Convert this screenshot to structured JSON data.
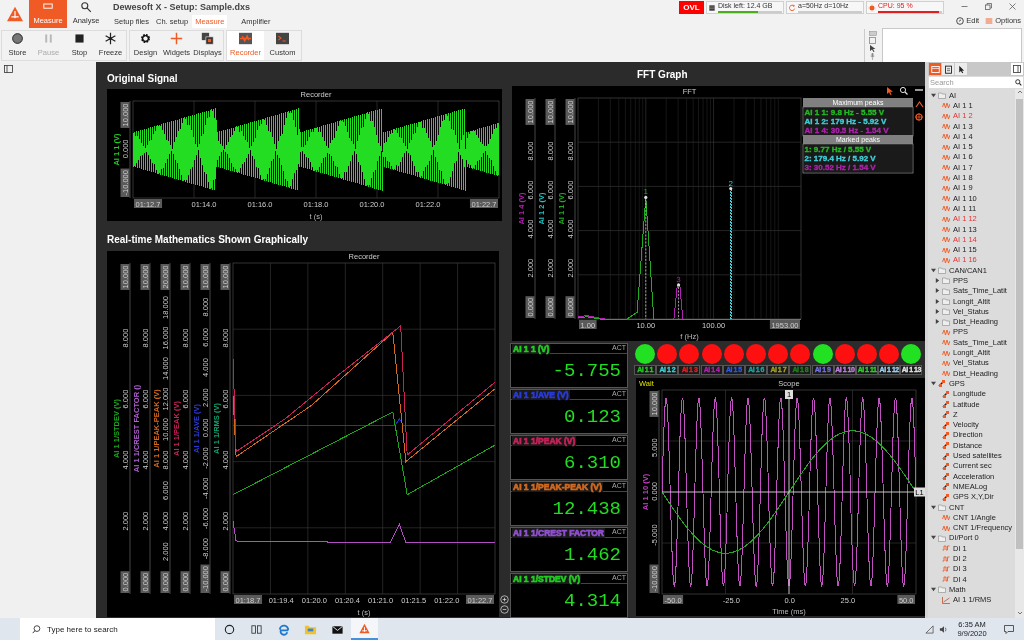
{
  "app_title": "Dewesoft X - Setup: Sample.dxs",
  "main_tabs": [
    {
      "label": "Measure",
      "kind": "measure",
      "selected": true
    },
    {
      "label": "Analyse",
      "kind": "analyse",
      "selected": false
    }
  ],
  "sub_tabs": [
    {
      "label": "Setup files",
      "selected": false
    },
    {
      "label": "Ch. setup",
      "selected": false
    },
    {
      "label": "Measure",
      "selected": true
    },
    {
      "label": "Amplifier",
      "selected": false
    }
  ],
  "toolbar_groups": [
    {
      "items": [
        {
          "label": "Store",
          "kind": "store",
          "disabled": false,
          "selected": false
        },
        {
          "label": "Pause",
          "kind": "pause",
          "disabled": true,
          "selected": false
        },
        {
          "label": "Stop",
          "kind": "stop",
          "disabled": false,
          "selected": false
        },
        {
          "label": "Freeze",
          "kind": "freeze",
          "disabled": false,
          "selected": false
        }
      ]
    },
    {
      "items": [
        {
          "label": "Design",
          "kind": "design",
          "disabled": false,
          "selected": false
        },
        {
          "label": "Widgets",
          "kind": "widgets",
          "disabled": false,
          "selected": false
        },
        {
          "label": "Displays",
          "kind": "displays",
          "disabled": false,
          "selected": false
        }
      ]
    },
    {
      "items": [
        {
          "label": "Recorder",
          "kind": "recorder",
          "disabled": false,
          "selected": true
        },
        {
          "label": "Custom",
          "kind": "custom",
          "disabled": false,
          "selected": false
        }
      ]
    }
  ],
  "overload": "OVL",
  "indicators": [
    {
      "kind": "disk",
      "text": "Disk left: 12.4 GB",
      "level": 0.62
    },
    {
      "kind": "rate",
      "text": "a=50Hz d=10Hz"
    },
    {
      "kind": "cpu",
      "text": "CPU: 95 %",
      "level": 0.95
    }
  ],
  "edit_button": "Edit",
  "options_button": "Options",
  "original_signal": {
    "heading": "Original Signal",
    "chart": {
      "title": "Recorder",
      "xlabel": "t (s)",
      "axes": [
        {
          "label": "AI 1 1 (V)",
          "color": "#22cc22",
          "ticks": [
            "10.000",
            "0.000",
            "-10.000"
          ]
        }
      ],
      "xticks": [
        "01:12.7",
        "01:14.0",
        "01:16.0",
        "01:18.0",
        "01:20.0",
        "01:22.0",
        "01:22.7"
      ],
      "traces": [
        {
          "kind": "burst",
          "color": "#22dd22"
        }
      ]
    }
  },
  "math": {
    "heading": "Real-time Mathematics Shown Graphically",
    "chart": {
      "title": "Recorder",
      "xlabel": "t (s)",
      "axes": [
        {
          "label": "AI 1 1/STDEV (V)",
          "color": "#1aa81a",
          "ticks": [
            "10.000",
            "8.000",
            "6.000",
            "4.000",
            "2.000",
            "0.000"
          ]
        },
        {
          "label": "AI 1 1/CREST FACTOR ()",
          "color": "#b060d0",
          "ticks": [
            "10.000",
            "8.000",
            "6.000",
            "4.000",
            "2.000",
            "0.000"
          ]
        },
        {
          "label": "AI 1 1/PEAK-PEAK (V)",
          "color": "#d2691e",
          "ticks": [
            "20.000",
            "18.000",
            "16.000",
            "14.000",
            "12.000",
            "10.000",
            "8.000",
            "6.000",
            "4.000",
            "2.000",
            "0.000"
          ]
        },
        {
          "label": "AI 1 1/PEAK (V)",
          "color": "#c8205a",
          "ticks": [
            "10.000",
            "8.000",
            "6.000",
            "4.000",
            "2.000",
            "0.000"
          ]
        },
        {
          "label": "AI 1 1/AVE (V)",
          "color": "#2a3ad8",
          "ticks": [
            "10.000",
            "8.000",
            "6.000",
            "4.000",
            "2.000",
            "0.000",
            "-2.000",
            "-4.000",
            "-6.000",
            "-8.000",
            "-10.000"
          ]
        },
        {
          "label": "AI 1 1/RMS (V)",
          "color": "#10a070",
          "ticks": [
            "10.000",
            "8.000",
            "6.000",
            "4.000",
            "2.000",
            "0.000"
          ]
        }
      ],
      "xticks": [
        "01:18.7",
        "01:19.4",
        "01:20.0",
        "01:20.4",
        "01:21.0",
        "01:21.5",
        "01:22.0",
        "01:22.7"
      ],
      "traces": [
        {
          "kind": "flat",
          "color": "#2a2ad0"
        },
        {
          "kind": "sawtooth_lead",
          "color": "#d2691e"
        },
        {
          "kind": "sawtooth",
          "color": "#c8205a"
        },
        {
          "kind": "sawtooth_low",
          "color": "#1aa81a"
        },
        {
          "kind": "pulse",
          "color": "#b050c0"
        }
      ]
    }
  },
  "fft": {
    "heading": "FFT Graph",
    "chart": {
      "title": "FFT",
      "xlabel": "f (Hz)",
      "axes": [
        {
          "label": "AI 1 4 (V)",
          "color": "#b020b0",
          "ticks": [
            "10.000",
            "8.000",
            "6.000",
            "4.000",
            "2.000",
            "0.000"
          ]
        },
        {
          "label": "AI 1 2 (V)",
          "color": "#20c0c0",
          "ticks": [
            "10.000",
            "8.000",
            "6.000",
            "4.000",
            "2.000",
            "0.000"
          ]
        },
        {
          "label": "AI 1 1 (V)",
          "color": "#22aa22",
          "ticks": [
            "10.000",
            "8.000",
            "6.000",
            "4.000",
            "2.000",
            "0.000"
          ]
        }
      ],
      "xticks": [
        "1.00",
        "10.00",
        "100.00",
        "1953.00"
      ],
      "traces": [
        {
          "kind": "peak_small",
          "color": "#b020b0",
          "marker": "3"
        },
        {
          "kind": "peak_wide",
          "color": "#22aa22",
          "marker": "1"
        },
        {
          "kind": "spike",
          "color": "#40d0d8",
          "marker": "2"
        }
      ]
    },
    "max_peaks": {
      "title": "Maximum peaks",
      "entries": [
        {
          "text": "AI 1 1: 9.8 Hz - 5.55 V",
          "color": "#22bb22"
        },
        {
          "text": "AI 1 2: 179 Hz - 5.92 V",
          "color": "#40d0d8"
        },
        {
          "text": "AI 1 4: 30.5 Hz - 1.54 V",
          "color": "#b020b0"
        }
      ]
    },
    "marked_peaks": {
      "title": "Marked peaks",
      "entries": [
        {
          "text": "1: 9.77 Hz / 5.55 V",
          "color": "#22bb22"
        },
        {
          "text": "2: 179.4 Hz / 5.92 V",
          "color": "#40d0d8"
        },
        {
          "text": "3: 30.52 Hz / 1.54 V",
          "color": "#b020b0"
        }
      ]
    }
  },
  "meters": [
    {
      "label": "AI 1 1 (V)",
      "color": "#22cc22",
      "mode": "ACT",
      "value": "-5.755"
    },
    {
      "label": "AI 1 1/AVE (V)",
      "color": "#2a3ad8",
      "mode": "ACT",
      "value": "0.123"
    },
    {
      "label": "AI 1 1/PEAK (V)",
      "color": "#c8205a",
      "mode": "ACT",
      "value": "6.310"
    },
    {
      "label": "AI 1 1/PEAK-PEAK (V)",
      "color": "#d2691e",
      "mode": "ACT",
      "value": "12.438"
    },
    {
      "label": "AI 1 1/CREST FACTOR",
      "color": "#9050d0",
      "mode": "ACT",
      "value": "1.462"
    },
    {
      "label": "AI 1 1/STDEV (V)",
      "color": "#22cc22",
      "mode": "ACT",
      "value": "4.314"
    }
  ],
  "leds": [
    {
      "label": "AI 1 1",
      "color": "#22cc22",
      "on": true
    },
    {
      "label": "AI 1 2",
      "color": "#40d0d8",
      "on": false
    },
    {
      "label": "AI 1 3",
      "color": "#e02020",
      "on": false
    },
    {
      "label": "AI 1 4",
      "color": "#b020b0",
      "on": false
    },
    {
      "label": "AI 1 5",
      "color": "#2a5ae8",
      "on": false
    },
    {
      "label": "AI 1 6",
      "color": "#20a0a0",
      "on": false
    },
    {
      "label": "AI 1 7",
      "color": "#a0a020",
      "on": false
    },
    {
      "label": "AI 1 8",
      "color": "#208020",
      "on": false
    },
    {
      "label": "AI 1 9",
      "color": "#7070e0",
      "on": true
    },
    {
      "label": "AI 1 10",
      "color": "#c080e0",
      "on": false
    },
    {
      "label": "AI 1 11",
      "color": "#30d030",
      "on": false
    },
    {
      "label": "AI 1 12",
      "color": "#a0d0f0",
      "on": false
    },
    {
      "label": "AI 1 13",
      "color": "#e0e0e0",
      "on": true
    }
  ],
  "scope": {
    "status": "Wait",
    "cursor_label": "1",
    "level_label": "L1",
    "chart": {
      "title": "Scope",
      "xlabel": "Time (ms)",
      "axes": [
        {
          "label": "AI 1 10 (V)",
          "color": "#c040c0",
          "ticks": [
            "10.000",
            "5.000",
            "0.000",
            "-5.000",
            "-10.000"
          ]
        }
      ],
      "xticks": [
        "-50.0",
        "-25.0",
        "0.0",
        "25.0",
        "50.0"
      ],
      "traces": [
        {
          "kind": "sine_fast",
          "color": "#c050c0"
        },
        {
          "kind": "sine_slow",
          "color": "#22a822"
        }
      ]
    }
  },
  "sidebar": {
    "tabs": [
      {
        "kind": "channels",
        "selected": true
      },
      {
        "kind": "list",
        "selected": false
      },
      {
        "kind": "pointer",
        "selected": false
      }
    ],
    "search": {
      "placeholder": "Search"
    },
    "tree": [
      {
        "label": "AI",
        "kind": "folder",
        "expanded": true,
        "children": [
          {
            "label": "AI 1 1",
            "kind": "analog",
            "active": false
          },
          {
            "label": "AI 1 2",
            "kind": "analog",
            "active": true
          },
          {
            "label": "AI 1 3",
            "kind": "analog",
            "active": false
          },
          {
            "label": "AI 1 4",
            "kind": "analog",
            "active": false
          },
          {
            "label": "AI 1 5",
            "kind": "analog",
            "active": false
          },
          {
            "label": "AI 1 6",
            "kind": "analog",
            "active": false
          },
          {
            "label": "AI 1 7",
            "kind": "analog",
            "active": false
          },
          {
            "label": "AI 1 8",
            "kind": "analog",
            "active": false
          },
          {
            "label": "AI 1 9",
            "kind": "analog",
            "active": false
          },
          {
            "label": "AI 1 10",
            "kind": "analog",
            "active": false
          },
          {
            "label": "AI 1 11",
            "kind": "analog",
            "active": false
          },
          {
            "label": "AI 1 12",
            "kind": "analog",
            "active": true
          },
          {
            "label": "AI 1 13",
            "kind": "analog",
            "active": false
          },
          {
            "label": "AI 1 14",
            "kind": "analog",
            "active": true
          },
          {
            "label": "AI 1 15",
            "kind": "analog",
            "active": false
          },
          {
            "label": "AI 1 16",
            "kind": "analog",
            "active": true
          }
        ]
      },
      {
        "label": "CAN/CAN1",
        "kind": "folder",
        "expanded": true,
        "children": [
          {
            "label": "PPS",
            "kind": "folder",
            "expanded": false
          },
          {
            "label": "Sats_Time_Latit",
            "kind": "folder",
            "expanded": false
          },
          {
            "label": "Longit_Altit",
            "kind": "folder",
            "expanded": false
          },
          {
            "label": "Vel_Status",
            "kind": "folder",
            "expanded": false
          },
          {
            "label": "Dist_Heading",
            "kind": "folder",
            "expanded": false
          },
          {
            "label": "PPS",
            "kind": "analog"
          },
          {
            "label": "Sats_Time_Latit",
            "kind": "analog"
          },
          {
            "label": "Longit_Altit",
            "kind": "analog"
          },
          {
            "label": "Vel_Status",
            "kind": "analog"
          },
          {
            "label": "Dist_Heading",
            "kind": "analog"
          }
        ]
      },
      {
        "label": "GPS",
        "kind": "gps_folder",
        "expanded": true,
        "children": [
          {
            "label": "Longitude",
            "kind": "gps"
          },
          {
            "label": "Latitude",
            "kind": "gps"
          },
          {
            "label": "Z",
            "kind": "gps"
          },
          {
            "label": "Velocity",
            "kind": "gps"
          },
          {
            "label": "Direction",
            "kind": "gps"
          },
          {
            "label": "Distance",
            "kind": "gps"
          },
          {
            "label": "Used satellites",
            "kind": "gps"
          },
          {
            "label": "Current sec",
            "kind": "gps"
          },
          {
            "label": "Acceleration",
            "kind": "gps"
          },
          {
            "label": "NMEALog",
            "kind": "gps"
          },
          {
            "label": "GPS X,Y,Dir",
            "kind": "gps"
          }
        ]
      },
      {
        "label": "CNT",
        "kind": "folder",
        "expanded": true,
        "children": [
          {
            "label": "CNT 1/Angle",
            "kind": "analog"
          },
          {
            "label": "CNT 1/Frequency",
            "kind": "analog"
          }
        ]
      },
      {
        "label": "DI/Port 0",
        "kind": "folder",
        "expanded": true,
        "children": [
          {
            "label": "DI 1",
            "kind": "digital"
          },
          {
            "label": "DI 2",
            "kind": "digital"
          },
          {
            "label": "DI 3",
            "kind": "digital"
          },
          {
            "label": "DI 4",
            "kind": "digital"
          }
        ]
      },
      {
        "label": "Math",
        "kind": "folder",
        "expanded": true,
        "children": [
          {
            "label": "AI 1 1/RMS",
            "kind": "math"
          }
        ]
      }
    ]
  },
  "taskbar": {
    "search_placeholder": "Type here to search",
    "apps": [
      {
        "kind": "cortana",
        "selected": false
      },
      {
        "kind": "taskview",
        "selected": false
      },
      {
        "kind": "browser",
        "selected": false
      },
      {
        "kind": "files",
        "selected": false
      },
      {
        "kind": "mail",
        "selected": false
      },
      {
        "kind": "dewesoft",
        "selected": true
      }
    ],
    "time": "6:35 AM",
    "date": "9/9/2020"
  }
}
